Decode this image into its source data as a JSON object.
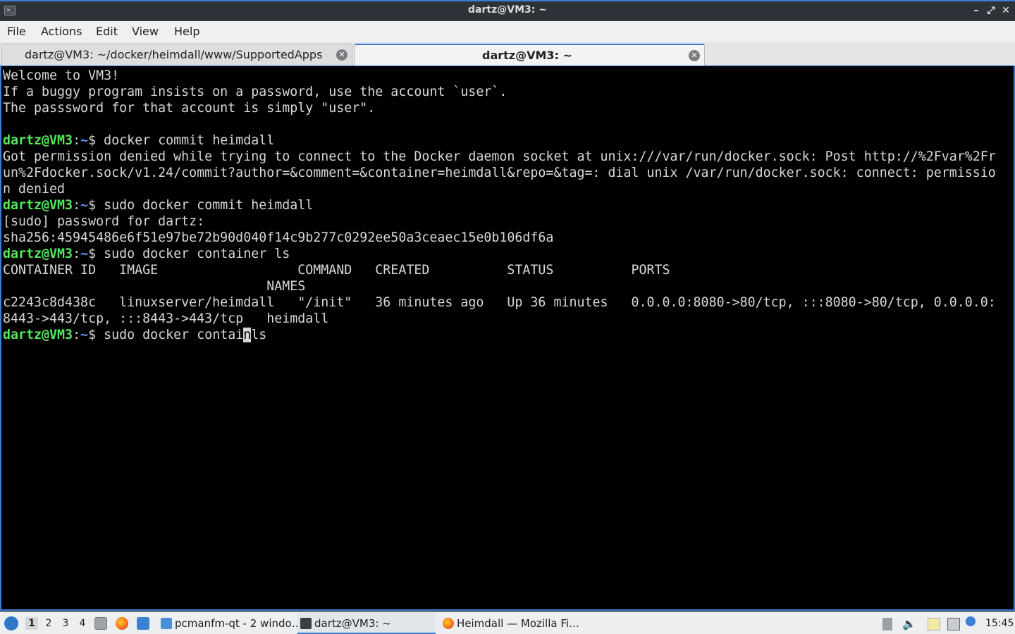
{
  "window": {
    "title": "dartz@VM3: ~",
    "minimize_glyph": "–",
    "maximize_glyph": "⤢",
    "close_glyph": "✕"
  },
  "menu": {
    "items": [
      "File",
      "Actions",
      "Edit",
      "View",
      "Help"
    ]
  },
  "tabs": [
    {
      "label": "dartz@VM3: ~/docker/heimdall/www/SupportedApps",
      "active": false
    },
    {
      "label": "dartz@VM3: ~",
      "active": true
    }
  ],
  "terminal": {
    "prompt_user": "dartz@VM3",
    "prompt_colon": ":",
    "prompt_path": "~",
    "prompt_symbol": "$ ",
    "lines": [
      {
        "type": "text",
        "text": "Welcome to VM3!"
      },
      {
        "type": "text",
        "text": "If a buggy program insists on a password, use the account `user`."
      },
      {
        "type": "text",
        "text": "The passsword for that account is simply \"user\"."
      },
      {
        "type": "text",
        "text": ""
      },
      {
        "type": "prompt",
        "text": "docker commit heimdall"
      },
      {
        "type": "text",
        "text": "Got permission denied while trying to connect to the Docker daemon socket at unix:///var/run/docker.sock: Post http://%2Fvar%2Fr"
      },
      {
        "type": "text",
        "text": "un%2Fdocker.sock/v1.24/commit?author=&comment=&container=heimdall&repo=&tag=: dial unix /var/run/docker.sock: connect: permissio"
      },
      {
        "type": "text",
        "text": "n denied"
      },
      {
        "type": "prompt",
        "text": "sudo docker commit heimdall"
      },
      {
        "type": "text",
        "text": "[sudo] password for dartz:"
      },
      {
        "type": "text",
        "text": "sha256:45945486e6f51e97be72b90d040f14c9b277c0292ee50a3ceaec15e0b106df6a"
      },
      {
        "type": "prompt",
        "text": "sudo docker container ls"
      },
      {
        "type": "text",
        "text": "CONTAINER ID   IMAGE                  COMMAND   CREATED          STATUS          PORTS"
      },
      {
        "type": "text",
        "text": "                                  NAMES"
      },
      {
        "type": "text",
        "text": "c2243c8d438c   linuxserver/heimdall   \"/init\"   36 minutes ago   Up 36 minutes   0.0.0.0:8080->80/tcp, :::8080->80/tcp, 0.0.0.0:"
      },
      {
        "type": "text",
        "text": "8443->443/tcp, :::8443->443/tcp   heimdall"
      },
      {
        "type": "prompt_cursor",
        "before": "sudo docker contai",
        "cursor": "n",
        "after": "ls"
      }
    ]
  },
  "taskbar": {
    "desktops": [
      "1",
      "2",
      "3",
      "4"
    ],
    "active_desktop": "1",
    "tasks": [
      {
        "label": "pcmanfm-qt - 2 windo…",
        "icon": "folder-icon"
      },
      {
        "label": "dartz@VM3: ~",
        "icon": "terminal-icon",
        "active": true
      },
      {
        "label": "Heimdall — Mozilla Fi…",
        "icon": "firefox-icon"
      }
    ],
    "clock": "15:45",
    "colors": {
      "accent": "#3d7fd6",
      "prompt_user": "#55e85a",
      "prompt_path": "#6a8cff"
    }
  }
}
